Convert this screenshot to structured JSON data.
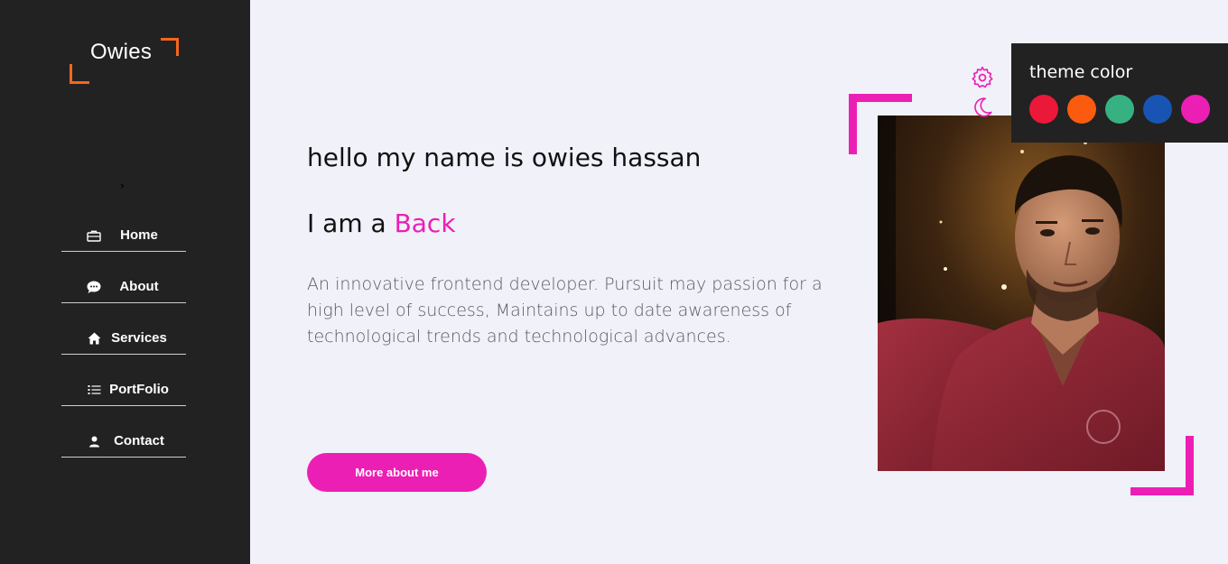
{
  "sidebar": {
    "logo": "Owies",
    "toggle_icon": "›",
    "items": [
      {
        "label": "Home",
        "icon": "briefcase-icon"
      },
      {
        "label": "About",
        "icon": "chat-icon"
      },
      {
        "label": "Services",
        "icon": "home-icon"
      },
      {
        "label": "PortFolio",
        "icon": "list-icon"
      },
      {
        "label": "Contact",
        "icon": "user-icon"
      }
    ]
  },
  "hero": {
    "greeting": "hello my name is owies hassan",
    "iam_prefix": "I am a ",
    "role": "Back",
    "bio": "An innovative frontend developer. Pursuit may passion for a high level of success, Maintains up to date awareness of technological trends and technological advances.",
    "button_label": "More about me"
  },
  "style_switcher": {
    "title": "theme color",
    "colors": [
      "#ec1839",
      "#fa5b0f",
      "#37b182",
      "#1854b4",
      "#ec1fb4"
    ]
  },
  "colors": {
    "accent": "#ec1fb4",
    "logo_accent": "#f4671f",
    "sidebar_bg": "#222222",
    "page_bg": "#f1f1fa"
  }
}
